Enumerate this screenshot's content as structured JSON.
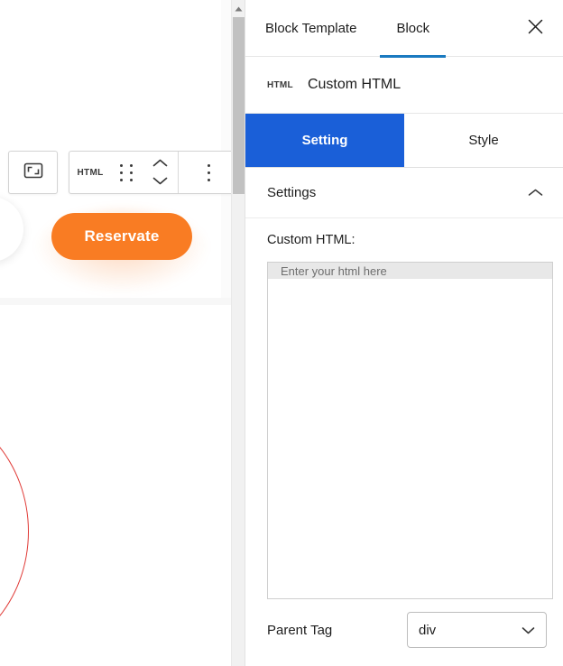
{
  "canvas": {
    "reservate_button_label": "Reservate",
    "toolbar": {
      "image_icon": "image-crop-icon",
      "block_type_label": "HTML",
      "drag_icon": "drag-handle-icon",
      "move_up_icon": "chevron-up-icon",
      "move_down_icon": "chevron-down-icon",
      "more_options_icon": "vertical-ellipsis-icon"
    },
    "scrollbar": {
      "up_arrow_icon": "scroll-up-arrow-icon"
    }
  },
  "panel": {
    "tabs": [
      {
        "label": "Block Template",
        "active": false
      },
      {
        "label": "Block",
        "active": true
      }
    ],
    "close_icon": "close-icon",
    "block": {
      "icon_label": "HTML",
      "title": "Custom HTML"
    },
    "segments": [
      {
        "label": "Setting",
        "active": true
      },
      {
        "label": "Style",
        "active": false
      }
    ],
    "settings_section": {
      "title": "Settings",
      "collapse_icon": "chevron-up-icon"
    },
    "custom_html": {
      "label": "Custom HTML:",
      "placeholder": "Enter your html here",
      "value": ""
    },
    "parent_tag": {
      "label": "Parent Tag",
      "value": "div",
      "dropdown_icon": "chevron-down-icon"
    }
  },
  "colors": {
    "accent_blue": "#1a5fd8",
    "tab_underline_blue": "#1a7ac0",
    "button_orange": "#f97c23",
    "decor_red": "#e03a36"
  }
}
